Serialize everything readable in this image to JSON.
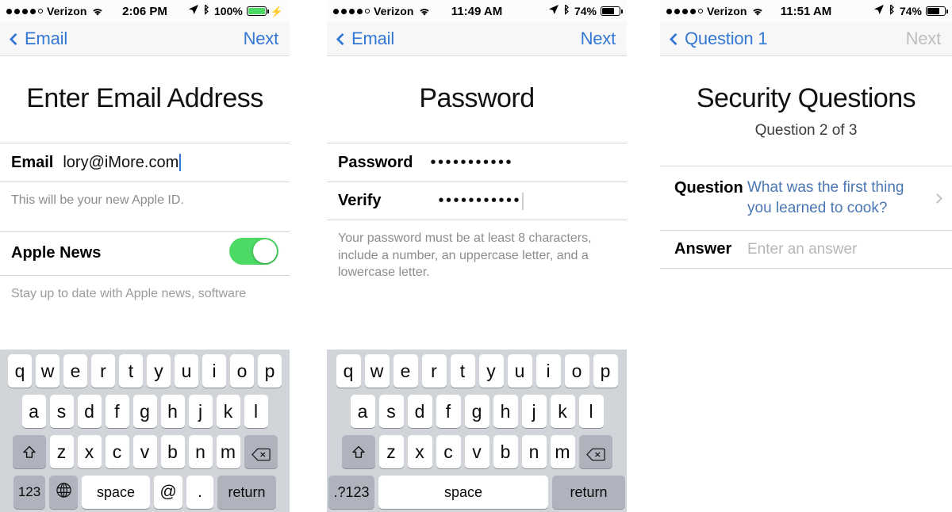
{
  "screens": [
    {
      "id": "enter-email-address",
      "statusbar": {
        "carrier": "Verizon",
        "signal_dots_filled": 4,
        "signal_dots_total": 5,
        "wifi_icon": "wifi-icon",
        "time": "2:06 PM",
        "location_icon": "location-arrow-icon",
        "bluetooth_icon": "bluetooth-icon",
        "battery_percent": "100%",
        "battery_level": 100,
        "battery_color": "#4cd964",
        "charging": true,
        "charging_icon": "lightning-bolt-icon"
      },
      "navbar": {
        "back_label": "Email",
        "back_icon": "chevron-left-icon",
        "next_label": "Next",
        "next_disabled": false
      },
      "title": "Enter Email Address",
      "subtitle": "",
      "fields": [
        {
          "label": "Email",
          "value": "lory@iMore.com",
          "caret": true
        }
      ],
      "footnote": "This will be your new Apple ID.",
      "toggle_row": {
        "label": "Apple News",
        "on": true,
        "color": "#4cd964"
      },
      "toggle_footnote": "Stay up to date with Apple news, software",
      "keyboard": {
        "row1": [
          "q",
          "w",
          "e",
          "r",
          "t",
          "y",
          "u",
          "i",
          "o",
          "p"
        ],
        "row2": [
          "a",
          "s",
          "d",
          "f",
          "g",
          "h",
          "j",
          "k",
          "l"
        ],
        "row3": [
          "z",
          "x",
          "c",
          "v",
          "b",
          "n",
          "m"
        ],
        "shift_icon": "shift-up-arrow-icon",
        "delete_icon": "backspace-delete-icon",
        "numeric_label": "123",
        "globe_icon": "globe-language-icon",
        "space_label": "space",
        "at_label": "@",
        "dot_label": ".",
        "return_label": "return"
      }
    },
    {
      "id": "password",
      "statusbar": {
        "carrier": "Verizon",
        "signal_dots_filled": 4,
        "signal_dots_total": 5,
        "wifi_icon": "wifi-icon",
        "time": "11:49 AM",
        "location_icon": "location-arrow-icon",
        "bluetooth_icon": "bluetooth-icon",
        "battery_percent": "74%",
        "battery_level": 74,
        "battery_color": "#000000",
        "charging": false,
        "charging_icon": ""
      },
      "navbar": {
        "back_label": "Email",
        "back_icon": "chevron-left-icon",
        "next_label": "Next",
        "next_disabled": false
      },
      "title": "Password",
      "subtitle": "",
      "fields": [
        {
          "label": "Password",
          "value": "•••••••••••",
          "caret": false
        },
        {
          "label": "Verify",
          "value": "•••••••••••",
          "caret": true
        }
      ],
      "footnote": "Your password must be at least 8 characters, include a number, an uppercase letter, and a lowercase letter.",
      "keyboard": {
        "row1": [
          "q",
          "w",
          "e",
          "r",
          "t",
          "y",
          "u",
          "i",
          "o",
          "p"
        ],
        "row2": [
          "a",
          "s",
          "d",
          "f",
          "g",
          "h",
          "j",
          "k",
          "l"
        ],
        "row3": [
          "z",
          "x",
          "c",
          "v",
          "b",
          "n",
          "m"
        ],
        "shift_icon": "shift-up-arrow-icon",
        "delete_icon": "backspace-delete-icon",
        "numeric_label": ".?123",
        "space_label": "space",
        "return_label": "return"
      }
    },
    {
      "id": "security-questions",
      "statusbar": {
        "carrier": "Verizon",
        "signal_dots_filled": 4,
        "signal_dots_total": 5,
        "wifi_icon": "wifi-icon",
        "time": "11:51 AM",
        "location_icon": "location-arrow-icon",
        "bluetooth_icon": "bluetooth-icon",
        "battery_percent": "74%",
        "battery_level": 74,
        "battery_color": "#000000",
        "charging": false,
        "charging_icon": ""
      },
      "navbar": {
        "back_label": "Question 1",
        "back_icon": "chevron-left-icon",
        "next_label": "Next",
        "next_disabled": true
      },
      "title": "Security Questions",
      "subtitle": "Question 2 of 3",
      "question_row": {
        "label": "Question",
        "value": "What was the first thing you learned to cook?",
        "chevron_icon": "chevron-right-icon"
      },
      "answer_row": {
        "label": "Answer",
        "placeholder": "Enter an answer",
        "value": ""
      }
    }
  ],
  "theme": {
    "accent_blue": "#3478d4",
    "link_blue": "#4a77b4",
    "disabled_grey": "#bfbfbf",
    "keyboard_bg": "#d1d4d9",
    "key_grey": "#aeb3bd",
    "separator": "#d4d4d4",
    "navbar_bg": "#f7f7f7",
    "toggle_green": "#4cd964"
  }
}
